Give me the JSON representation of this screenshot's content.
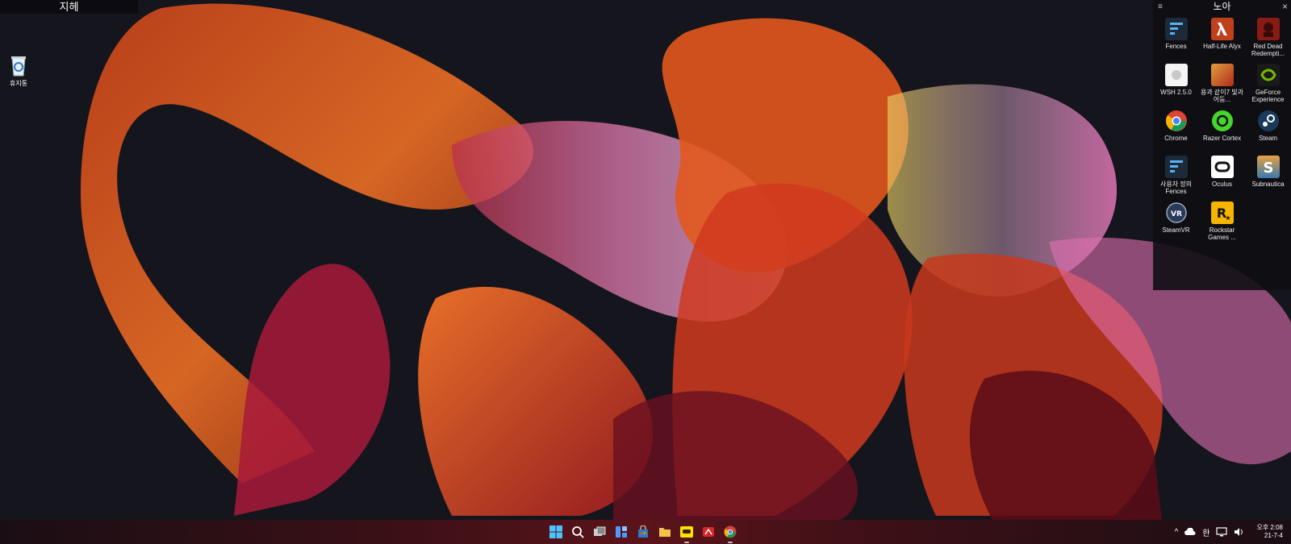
{
  "left_fence": {
    "title": "지헤"
  },
  "desktop": {
    "recycle_bin_label": "휴지통"
  },
  "right_fence": {
    "title": "노아",
    "menu_glyph": "≡",
    "close_glyph": "×",
    "apps": [
      {
        "label": "Fences",
        "icon": "fences-icon"
      },
      {
        "label": "Half-Life Alyx",
        "icon": "half-life-alyx-icon"
      },
      {
        "label": "Red Dead Redempti...",
        "icon": "red-dead-redemption-icon"
      },
      {
        "label": "WSH 2.5.0",
        "icon": "wsh-icon"
      },
      {
        "label": "용과 같이7 빛과 어둠...",
        "icon": "yakuza-7-icon"
      },
      {
        "label": "GeForce Experience",
        "icon": "geforce-experience-icon"
      },
      {
        "label": "Chrome",
        "icon": "chrome-icon"
      },
      {
        "label": "Razer Cortex",
        "icon": "razer-cortex-icon"
      },
      {
        "label": "Steam",
        "icon": "steam-icon"
      },
      {
        "label": "사용자 정의 Fences",
        "icon": "fences-custom-icon"
      },
      {
        "label": "Oculus",
        "icon": "oculus-icon"
      },
      {
        "label": "Subnautica",
        "icon": "subnautica-icon"
      },
      {
        "label": "SteamVR",
        "icon": "steamvr-icon"
      },
      {
        "label": "Rockstar Games ...",
        "icon": "rockstar-games-icon"
      }
    ]
  },
  "taskbar": {
    "ime": "한",
    "clock_time": "오후 2:08",
    "clock_date": "21-7-4"
  },
  "colors": {
    "accent": "#e05a1c",
    "taskbar_red": "#5a141a"
  }
}
